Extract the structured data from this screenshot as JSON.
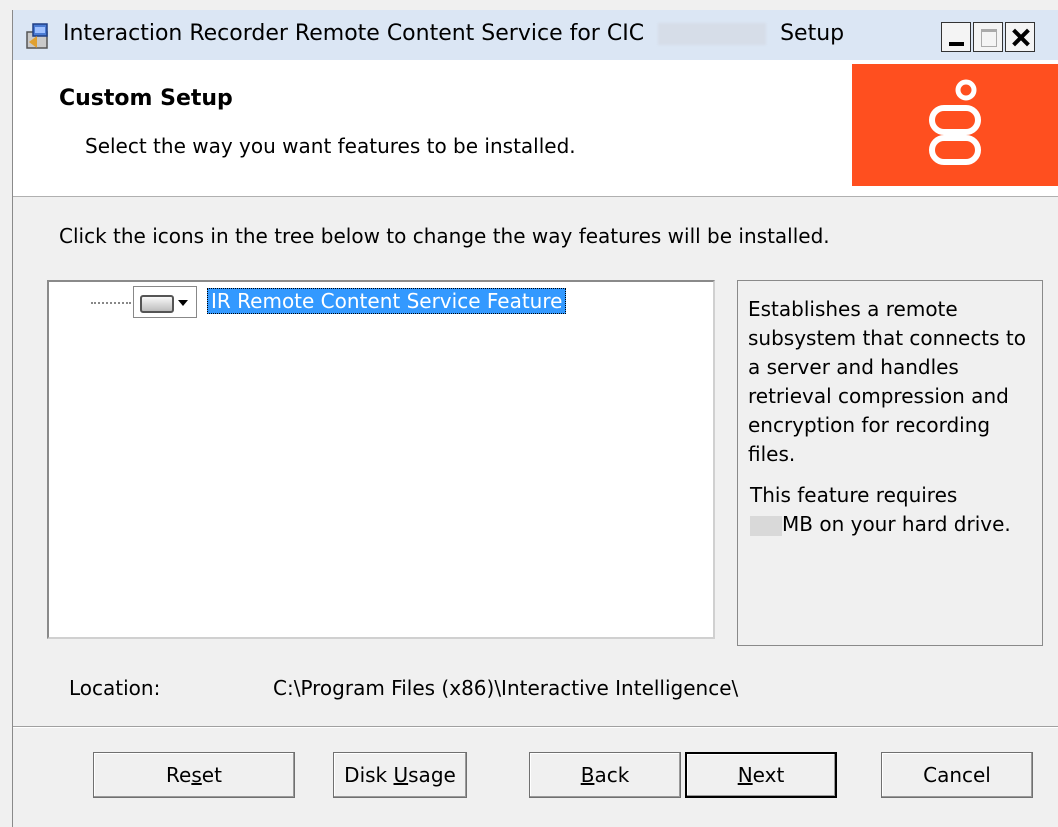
{
  "window": {
    "title_prefix": "Interaction Recorder Remote Content Service for CIC",
    "title_suffix": "Setup"
  },
  "banner": {
    "title": "Custom Setup",
    "subtitle": "Select the way you want features to be installed."
  },
  "instructions": "Click the icons in the tree below to change the way features will be installed.",
  "tree": {
    "items": [
      {
        "label": "IR Remote Content Service Feature",
        "selected": true
      }
    ]
  },
  "description": {
    "text": "Establishes a remote subsystem that connects to a server and handles retrieval compression and encryption for recording files.",
    "requirement_prefix": "This feature requires",
    "requirement_suffix": "MB on your hard drive."
  },
  "location": {
    "label": "Location:",
    "value": "C:\\Program Files (x86)\\Interactive Intelligence\\"
  },
  "buttons": {
    "reset": {
      "pre": "Re",
      "key": "s",
      "post": "et"
    },
    "disk": {
      "pre": "Disk ",
      "key": "U",
      "post": "sage"
    },
    "back": {
      "pre": "",
      "key": "B",
      "post": "ack"
    },
    "next": {
      "pre": "",
      "key": "N",
      "post": "ext"
    },
    "cancel": {
      "pre": "Cancel",
      "key": "",
      "post": ""
    }
  },
  "colors": {
    "brand": "#ff4f1f",
    "selection": "#3399ff",
    "titlebar": "#dbe6f4"
  },
  "icons": [
    "installer-icon",
    "minimize-icon",
    "maximize-icon",
    "close-icon",
    "logo-icon",
    "drive-icon",
    "dropdown-arrow-icon"
  ]
}
